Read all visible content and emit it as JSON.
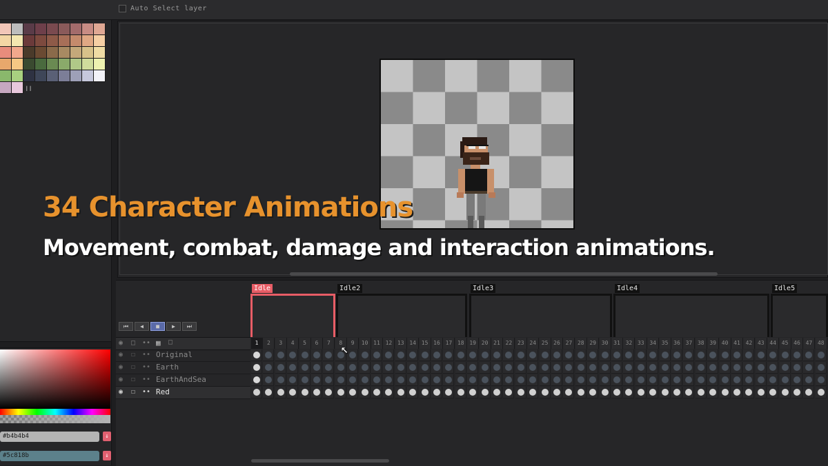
{
  "toolbar": {
    "auto_select_label": "Auto Select layer"
  },
  "palette": {
    "colors": [
      "#f2c6b8",
      "#bdbdbd",
      "#5a3b48",
      "#6e3f4a",
      "#7a4a4f",
      "#8a5a5a",
      "#a36b6b",
      "#c88c84",
      "#e0a894",
      "#f3d6a4",
      "#f4e7b0",
      "#6b3a3a",
      "#7d4a3e",
      "#8e5a48",
      "#a86f58",
      "#c58a6c",
      "#e0a884",
      "#f6cfa4",
      "#e88c7c",
      "#f2a88c",
      "#4a3a2a",
      "#6a4a32",
      "#8a6a4a",
      "#a88a62",
      "#c4a87a",
      "#d8c28a",
      "#f0dca4",
      "#e8a86c",
      "#f6c884",
      "#3a4a30",
      "#4a6a3e",
      "#6a8a52",
      "#8aaa6a",
      "#b0c888",
      "#d0dc9c",
      "#eef2b0",
      "#8ab86c",
      "#a8d080",
      "#2e3242",
      "#3e4658",
      "#5a6076",
      "#7c7e98",
      "#9ea0b8",
      "#c6c8dc",
      "#f2f2f8",
      "#c6a8c0",
      "#e8c8dc"
    ],
    "more_label": "❙❙"
  },
  "color": {
    "primary_hex": "#b4b4b4",
    "secondary_hex": "#5c818b",
    "button_glyph": "↓"
  },
  "overlay": {
    "headline": "34 Character Animations",
    "subline": "Movement, combat, damage and interaction animations."
  },
  "timeline": {
    "tags": [
      "Idle",
      "Idle2",
      "Idle3",
      "Idle4",
      "Idle5"
    ],
    "playback": [
      "⏮",
      "◀",
      "■",
      "▶",
      "⏭"
    ],
    "layers": [
      {
        "name": "Original",
        "selected": false
      },
      {
        "name": "Earth",
        "selected": false
      },
      {
        "name": "EarthAndSea",
        "selected": false
      },
      {
        "name": "Red",
        "selected": true
      }
    ],
    "frame_count": 48,
    "current_frame": 1,
    "header_icons": [
      "eye-icon",
      "lock-icon",
      "link-icon",
      "new-layer-icon",
      "frame-icon"
    ]
  }
}
